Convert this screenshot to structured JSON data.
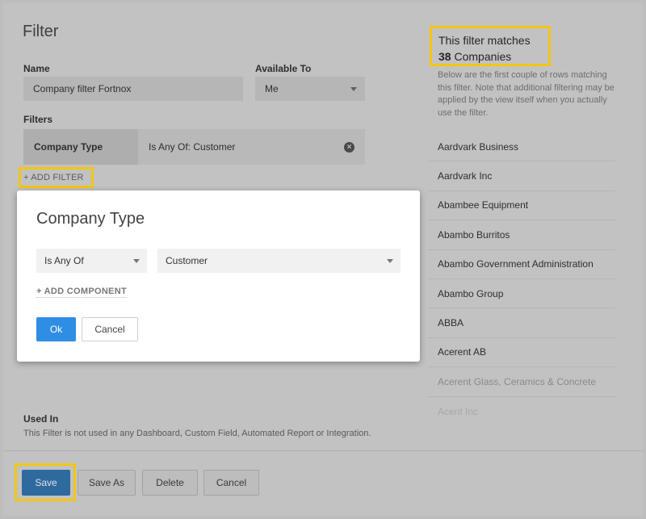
{
  "page": {
    "title": "Filter",
    "name_label": "Name",
    "name_value": "Company filter Fortnox",
    "available_label": "Available To",
    "available_value": "Me",
    "filters_label": "Filters",
    "filter_key": "Company Type",
    "filter_value": "Is Any Of: Customer",
    "add_filter_label": "+ ADD FILTER",
    "used_in_label": "Used In",
    "used_in_text": "This Filter is not used in any Dashboard, Custom Field, Automated Report or Integration."
  },
  "matches": {
    "line1": "This filter matches",
    "count": "38",
    "unit": "Companies",
    "description": "Below are the first couple of rows matching this filter. Note that additional filtering may be applied by the view itself when you actually use the filter."
  },
  "companies": [
    "Aardvark Business",
    "Aardvark Inc",
    "Abambee Equipment",
    "Abambo Burritos",
    "Abambo Government Administration",
    "Abambo Group",
    "ABBA",
    "Acerent AB",
    "Acerent Glass, Ceramics & Concrete",
    "Acent Inc"
  ],
  "footer": {
    "save": "Save",
    "save_as": "Save As",
    "delete": "Delete",
    "cancel": "Cancel"
  },
  "modal": {
    "title": "Company Type",
    "operator": "Is Any Of",
    "value": "Customer",
    "add_component": "+ ADD COMPONENT",
    "ok": "Ok",
    "cancel": "Cancel"
  },
  "colors": {
    "highlight": "#f3c614",
    "primary": "#2f8de4",
    "save_dimmed": "#2f6a9e"
  }
}
